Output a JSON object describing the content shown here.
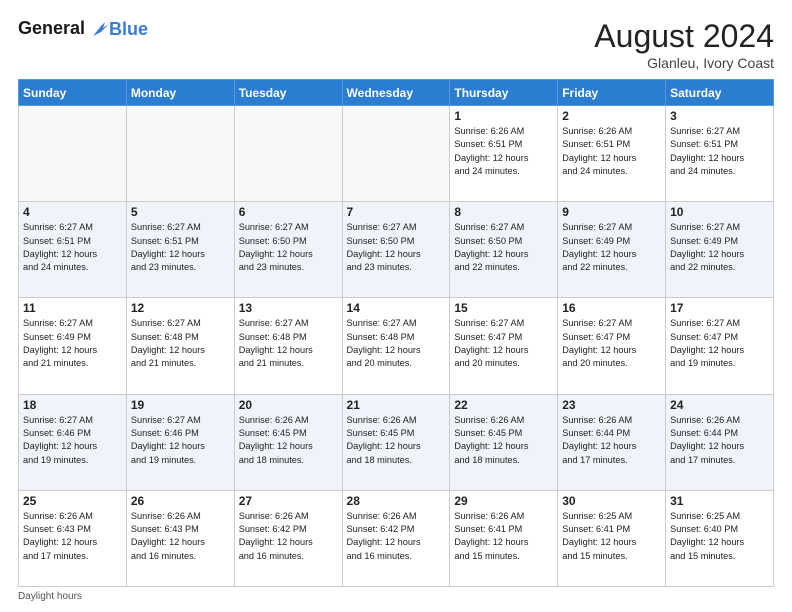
{
  "header": {
    "logo_line1": "General",
    "logo_line2": "Blue",
    "month_year": "August 2024",
    "location": "Glanleu, Ivory Coast"
  },
  "days_of_week": [
    "Sunday",
    "Monday",
    "Tuesday",
    "Wednesday",
    "Thursday",
    "Friday",
    "Saturday"
  ],
  "weeks": [
    [
      {
        "day": "",
        "info": ""
      },
      {
        "day": "",
        "info": ""
      },
      {
        "day": "",
        "info": ""
      },
      {
        "day": "",
        "info": ""
      },
      {
        "day": "1",
        "info": "Sunrise: 6:26 AM\nSunset: 6:51 PM\nDaylight: 12 hours\nand 24 minutes."
      },
      {
        "day": "2",
        "info": "Sunrise: 6:26 AM\nSunset: 6:51 PM\nDaylight: 12 hours\nand 24 minutes."
      },
      {
        "day": "3",
        "info": "Sunrise: 6:27 AM\nSunset: 6:51 PM\nDaylight: 12 hours\nand 24 minutes."
      }
    ],
    [
      {
        "day": "4",
        "info": "Sunrise: 6:27 AM\nSunset: 6:51 PM\nDaylight: 12 hours\nand 24 minutes."
      },
      {
        "day": "5",
        "info": "Sunrise: 6:27 AM\nSunset: 6:51 PM\nDaylight: 12 hours\nand 23 minutes."
      },
      {
        "day": "6",
        "info": "Sunrise: 6:27 AM\nSunset: 6:50 PM\nDaylight: 12 hours\nand 23 minutes."
      },
      {
        "day": "7",
        "info": "Sunrise: 6:27 AM\nSunset: 6:50 PM\nDaylight: 12 hours\nand 23 minutes."
      },
      {
        "day": "8",
        "info": "Sunrise: 6:27 AM\nSunset: 6:50 PM\nDaylight: 12 hours\nand 22 minutes."
      },
      {
        "day": "9",
        "info": "Sunrise: 6:27 AM\nSunset: 6:49 PM\nDaylight: 12 hours\nand 22 minutes."
      },
      {
        "day": "10",
        "info": "Sunrise: 6:27 AM\nSunset: 6:49 PM\nDaylight: 12 hours\nand 22 minutes."
      }
    ],
    [
      {
        "day": "11",
        "info": "Sunrise: 6:27 AM\nSunset: 6:49 PM\nDaylight: 12 hours\nand 21 minutes."
      },
      {
        "day": "12",
        "info": "Sunrise: 6:27 AM\nSunset: 6:48 PM\nDaylight: 12 hours\nand 21 minutes."
      },
      {
        "day": "13",
        "info": "Sunrise: 6:27 AM\nSunset: 6:48 PM\nDaylight: 12 hours\nand 21 minutes."
      },
      {
        "day": "14",
        "info": "Sunrise: 6:27 AM\nSunset: 6:48 PM\nDaylight: 12 hours\nand 20 minutes."
      },
      {
        "day": "15",
        "info": "Sunrise: 6:27 AM\nSunset: 6:47 PM\nDaylight: 12 hours\nand 20 minutes."
      },
      {
        "day": "16",
        "info": "Sunrise: 6:27 AM\nSunset: 6:47 PM\nDaylight: 12 hours\nand 20 minutes."
      },
      {
        "day": "17",
        "info": "Sunrise: 6:27 AM\nSunset: 6:47 PM\nDaylight: 12 hours\nand 19 minutes."
      }
    ],
    [
      {
        "day": "18",
        "info": "Sunrise: 6:27 AM\nSunset: 6:46 PM\nDaylight: 12 hours\nand 19 minutes."
      },
      {
        "day": "19",
        "info": "Sunrise: 6:27 AM\nSunset: 6:46 PM\nDaylight: 12 hours\nand 19 minutes."
      },
      {
        "day": "20",
        "info": "Sunrise: 6:26 AM\nSunset: 6:45 PM\nDaylight: 12 hours\nand 18 minutes."
      },
      {
        "day": "21",
        "info": "Sunrise: 6:26 AM\nSunset: 6:45 PM\nDaylight: 12 hours\nand 18 minutes."
      },
      {
        "day": "22",
        "info": "Sunrise: 6:26 AM\nSunset: 6:45 PM\nDaylight: 12 hours\nand 18 minutes."
      },
      {
        "day": "23",
        "info": "Sunrise: 6:26 AM\nSunset: 6:44 PM\nDaylight: 12 hours\nand 17 minutes."
      },
      {
        "day": "24",
        "info": "Sunrise: 6:26 AM\nSunset: 6:44 PM\nDaylight: 12 hours\nand 17 minutes."
      }
    ],
    [
      {
        "day": "25",
        "info": "Sunrise: 6:26 AM\nSunset: 6:43 PM\nDaylight: 12 hours\nand 17 minutes."
      },
      {
        "day": "26",
        "info": "Sunrise: 6:26 AM\nSunset: 6:43 PM\nDaylight: 12 hours\nand 16 minutes."
      },
      {
        "day": "27",
        "info": "Sunrise: 6:26 AM\nSunset: 6:42 PM\nDaylight: 12 hours\nand 16 minutes."
      },
      {
        "day": "28",
        "info": "Sunrise: 6:26 AM\nSunset: 6:42 PM\nDaylight: 12 hours\nand 16 minutes."
      },
      {
        "day": "29",
        "info": "Sunrise: 6:26 AM\nSunset: 6:41 PM\nDaylight: 12 hours\nand 15 minutes."
      },
      {
        "day": "30",
        "info": "Sunrise: 6:25 AM\nSunset: 6:41 PM\nDaylight: 12 hours\nand 15 minutes."
      },
      {
        "day": "31",
        "info": "Sunrise: 6:25 AM\nSunset: 6:40 PM\nDaylight: 12 hours\nand 15 minutes."
      }
    ]
  ],
  "footer": {
    "note": "Daylight hours"
  }
}
